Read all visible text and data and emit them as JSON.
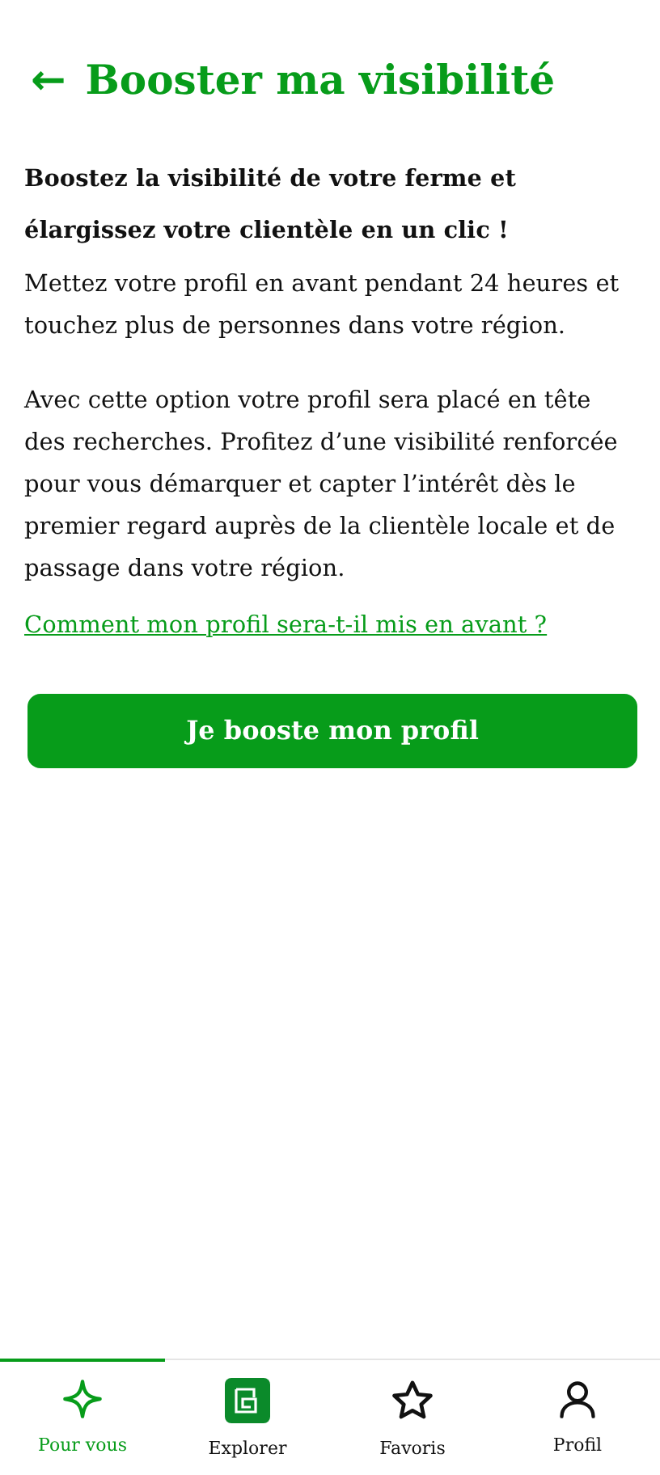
{
  "header": {
    "back_icon": "←",
    "title": "Booster ma visibilité"
  },
  "intro": "Boostez la visibilité de votre ferme et élargissez votre clientèle en un clic !",
  "paragraphs": [
    "Mettez votre profil en avant pendant 24 heures et touchez plus de personnes dans votre région.",
    "Avec cette option votre profil sera placé en tête des recherches. Profitez d’une visibilité renforcée pour vous démarquer et capter l’intérêt dès le premier regard auprès de la clientèle locale et de passage dans votre région."
  ],
  "link": "Comment mon profil sera-t-il mis en avant ?",
  "button": "Je booste mon profil",
  "nav": [
    {
      "kind": "sparkle",
      "label": "Pour vous",
      "selected": true
    },
    {
      "kind": "explore",
      "label": "Explorer",
      "selected": false
    },
    {
      "kind": "star",
      "label": "Favoris",
      "selected": false
    },
    {
      "kind": "person",
      "label": "Profil",
      "selected": false
    }
  ]
}
